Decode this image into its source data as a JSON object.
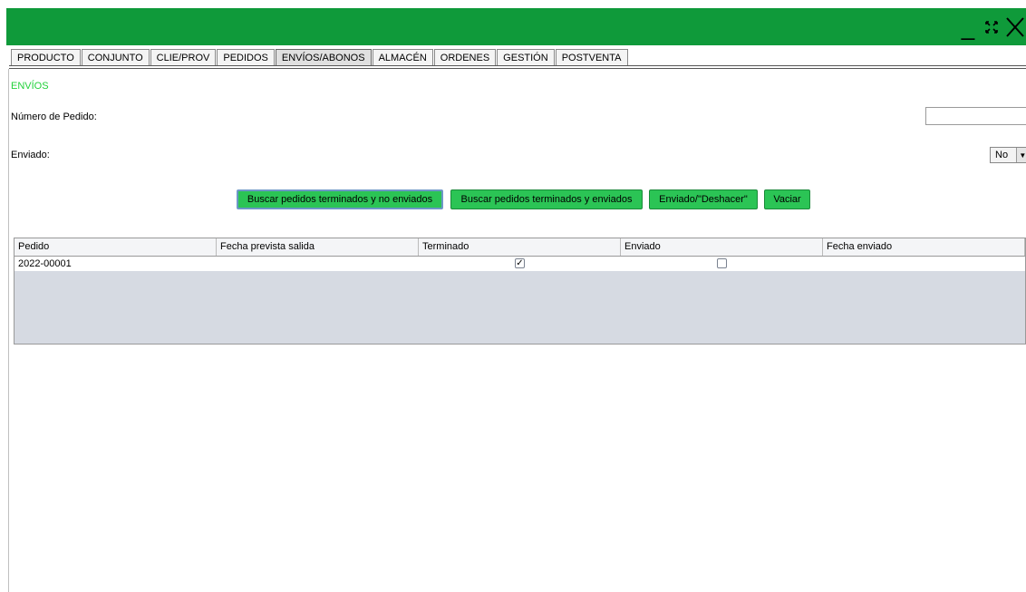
{
  "window": {
    "minimize_glyph": "_",
    "maximize_icon": "expand-arrows-icon",
    "close_icon": "close-x-icon",
    "title_bar_color": "#0f9a3a"
  },
  "tabs": [
    {
      "label": "PRODUCTO"
    },
    {
      "label": "CONJUNTO"
    },
    {
      "label": "CLIE/PROV"
    },
    {
      "label": "PEDIDOS"
    },
    {
      "label": "ENVÍOS/ABONOS"
    },
    {
      "label": "ALMACÉN"
    },
    {
      "label": "ORDENES"
    },
    {
      "label": "GESTIÓN"
    },
    {
      "label": "POSTVENTA"
    }
  ],
  "section": {
    "title": "ENVÍOS",
    "title_color": "#22d13a"
  },
  "form": {
    "order_label": "Número de Pedido:",
    "order_value": "",
    "sent_label": "Enviado:",
    "sent_value": "No"
  },
  "buttons": {
    "search_not_sent": "Buscar pedidos terminados y no enviados",
    "search_sent": "Buscar pedidos terminados y enviados",
    "toggle_sent": "Enviado/\"Deshacer\"",
    "clear": "Vaciar",
    "color": "#2bc455"
  },
  "table": {
    "columns": [
      "Pedido",
      "Fecha prevista salida",
      "Terminado",
      "Enviado",
      "Fecha enviado"
    ],
    "rows": [
      {
        "pedido": "2022-00001",
        "fecha_prevista": "",
        "terminado": true,
        "enviado": false,
        "fecha_enviado": ""
      }
    ]
  }
}
